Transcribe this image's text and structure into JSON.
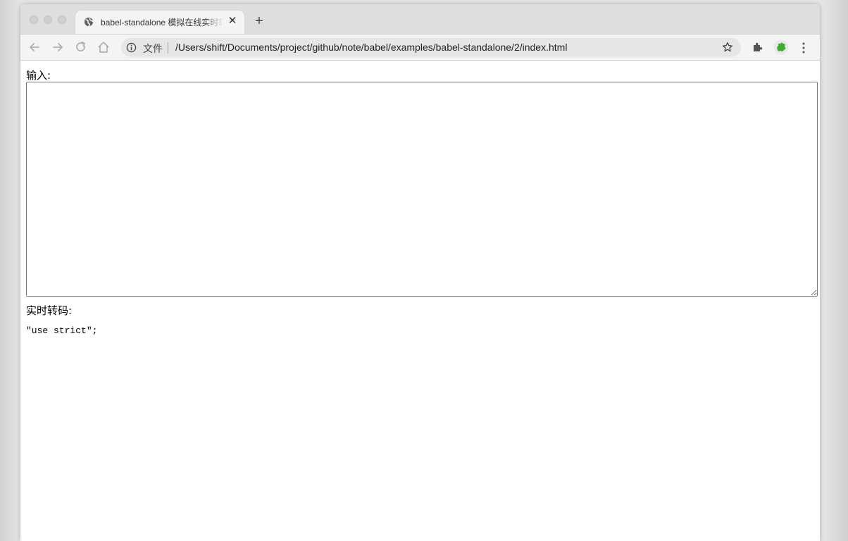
{
  "browser": {
    "tab": {
      "title": "babel-standalone 模拟在线实时转码",
      "favicon": "globe-icon"
    },
    "toolbar": {
      "security_label": "文件",
      "url": "/Users/shift/Documents/project/github/note/babel/examples/babel-standalone/2/index.html"
    },
    "icons": {
      "back": "arrow-left-icon",
      "forward": "arrow-right-icon",
      "reload": "reload-icon",
      "home": "home-icon",
      "bookmark": "star-icon",
      "extensions": "puzzle-icon",
      "profile": "profile-icon",
      "menu": "kebab-menu-icon"
    }
  },
  "page": {
    "input_label": "输入:",
    "input_value": "",
    "output_label": "实时转码:",
    "output_code": "\"use strict\";"
  },
  "colors": {
    "profile_green": "#3fae2a"
  }
}
